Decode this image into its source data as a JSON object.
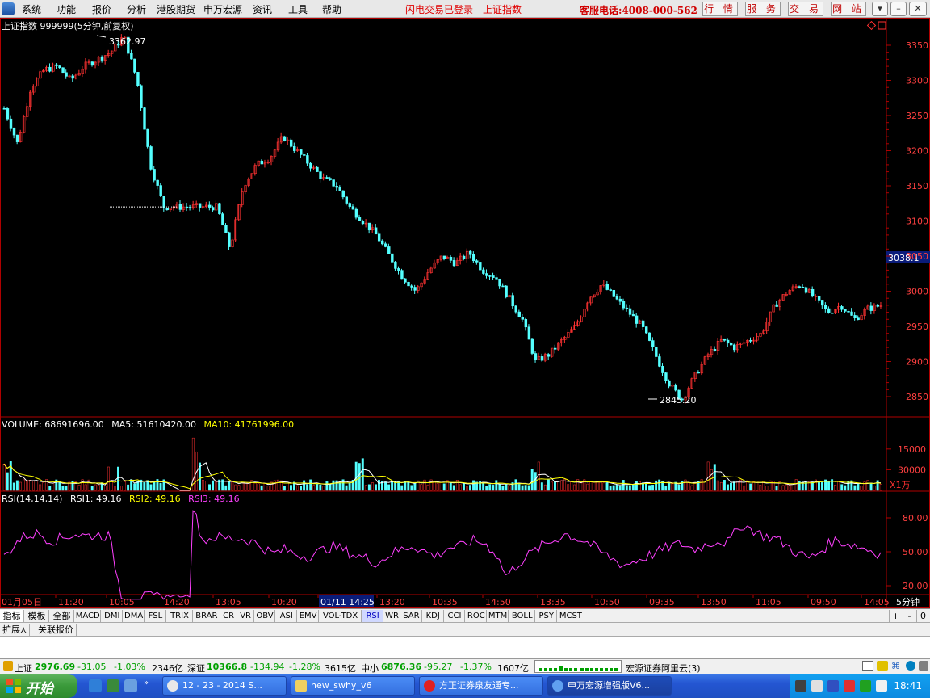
{
  "menubar": {
    "items": [
      "系统",
      "功能",
      "报价",
      "分析",
      "港股期货",
      "申万宏源",
      "资讯",
      "工具",
      "帮助"
    ],
    "status": "闪电交易已登录",
    "current_symbol": "上证指数",
    "hotline": "客服电话:4008-000-562",
    "right_buttons": [
      "行 情",
      "服 务",
      "交 易",
      "网 站"
    ]
  },
  "chart": {
    "title": "上证指数 999999(5分钟,前复权)",
    "high_label": "3362.97",
    "low_label": "2845.20",
    "price_ticks": [
      "3350",
      "3300",
      "3250",
      "3200",
      "3150",
      "3100",
      "3050",
      "3000",
      "2950",
      "2900",
      "2850"
    ],
    "current_price": "3038.1",
    "volume_header": {
      "volume": "VOLUME: 68691696.00",
      "ma5": "MA5: 51610420.00",
      "ma10": "MA10: 41761996.00"
    },
    "volume_ticks": [
      "30000",
      "15000"
    ],
    "volume_unit": "X1万",
    "rsi_header": {
      "name": "RSI(14,14,14)",
      "rsi1": "RSI1: 49.16",
      "rsi2": "RSI2: 49.16",
      "rsi3": "RSI3: 49.16"
    },
    "rsi_ticks": [
      "80.00",
      "50.00",
      "20.00"
    ],
    "time_labels": [
      "01月05日",
      "11:20",
      "10:05",
      "14:20",
      "13:05",
      "10:20",
      "01/11 14:25",
      "13:20",
      "10:35",
      "14:50",
      "13:35",
      "10:50",
      "09:35",
      "13:50",
      "11:05",
      "09:50",
      "14:05"
    ],
    "period_label": "5分钟"
  },
  "colors": {
    "up": "#ff3232",
    "down": "#54ffff",
    "grid": "#b00000",
    "ma5": "#ffffff",
    "ma10": "#ffff00",
    "rsi": "#ff40ff"
  },
  "chart_data": {
    "type": "candlestick",
    "title": "上证指数 999999(5分钟,前复权)",
    "price_range": [
      2830,
      3370
    ],
    "price_path": [
      3260,
      3210,
      3290,
      3315,
      3320,
      3300,
      3320,
      3330,
      3340,
      3362.97,
      3300,
      3180,
      3120,
      3120,
      3120,
      3120,
      3120,
      3060,
      3150,
      3180,
      3190,
      3220,
      3200,
      3180,
      3160,
      3150,
      3120,
      3100,
      3080,
      3050,
      3020,
      3000,
      3030,
      3050,
      3040,
      3055,
      3030,
      3020,
      2990,
      2960,
      2900,
      2910,
      2930,
      2950,
      2990,
      3010,
      2990,
      2970,
      2950,
      2910,
      2870,
      2845.2,
      2880,
      2910,
      2930,
      2920,
      2930,
      2940,
      2980,
      3000,
      3010,
      2990,
      2970,
      2980,
      2960,
      2975,
      2980
    ],
    "volume_range": [
      0,
      40000
    ],
    "volume_ticks": [
      15000,
      30000
    ],
    "rsi_path": [
      45,
      58,
      65,
      66,
      60,
      62,
      66,
      64,
      65,
      64,
      12,
      10,
      10,
      10,
      10,
      10,
      95,
      60,
      63,
      62,
      62,
      60,
      55,
      48,
      52,
      48,
      46,
      50,
      55,
      52,
      47,
      44,
      40,
      48,
      52,
      56,
      50,
      46,
      54,
      54,
      60,
      58,
      50,
      28,
      40,
      48,
      55,
      60,
      66,
      62,
      58,
      50,
      44,
      38,
      42,
      46,
      50,
      55,
      57,
      52,
      56,
      60,
      58,
      74,
      70,
      64,
      62,
      55,
      48,
      44,
      52,
      60,
      58,
      55,
      52,
      48
    ]
  },
  "tabs": [
    "指标",
    "模板",
    "全部",
    "MACD",
    "DMI",
    "DMA",
    "FSL",
    "TRIX",
    "BRAR",
    "CR",
    "VR",
    "OBV",
    "ASI",
    "EMV",
    "VOL-TDX",
    "RSI",
    "WR",
    "SAR",
    "KDJ",
    "CCI",
    "ROC",
    "MTM",
    "BOLL",
    "PSY",
    "MCST"
  ],
  "tab_controls": [
    "+",
    "-",
    "0"
  ],
  "subtabs": [
    "扩展⋏",
    "关联报价"
  ],
  "ticker": {
    "sh_name": "上证",
    "sh_value": "2976.69",
    "sh_change": "-31.05",
    "sh_pct": "-1.03%",
    "sh_amount": "2346亿",
    "sz_name": "深证",
    "sz_value": "10366.8",
    "sz_change": "-134.94",
    "sz_pct": "-1.28%",
    "sz_amount": "3615亿",
    "zx_name": "中小",
    "zx_value": "6876.36",
    "zx_change": "-95.27",
    "zx_pct": "-1.37%",
    "zx_amount": "1607亿",
    "broker": "宏源证券阿里云(3)"
  },
  "taskbar": {
    "start_label": "开始",
    "tasks": [
      "12 - 23 - 2014 S...",
      "new_swhy_v6",
      "方正证券泉友通专...",
      "申万宏源增强版V6..."
    ],
    "clock": "18:41"
  }
}
